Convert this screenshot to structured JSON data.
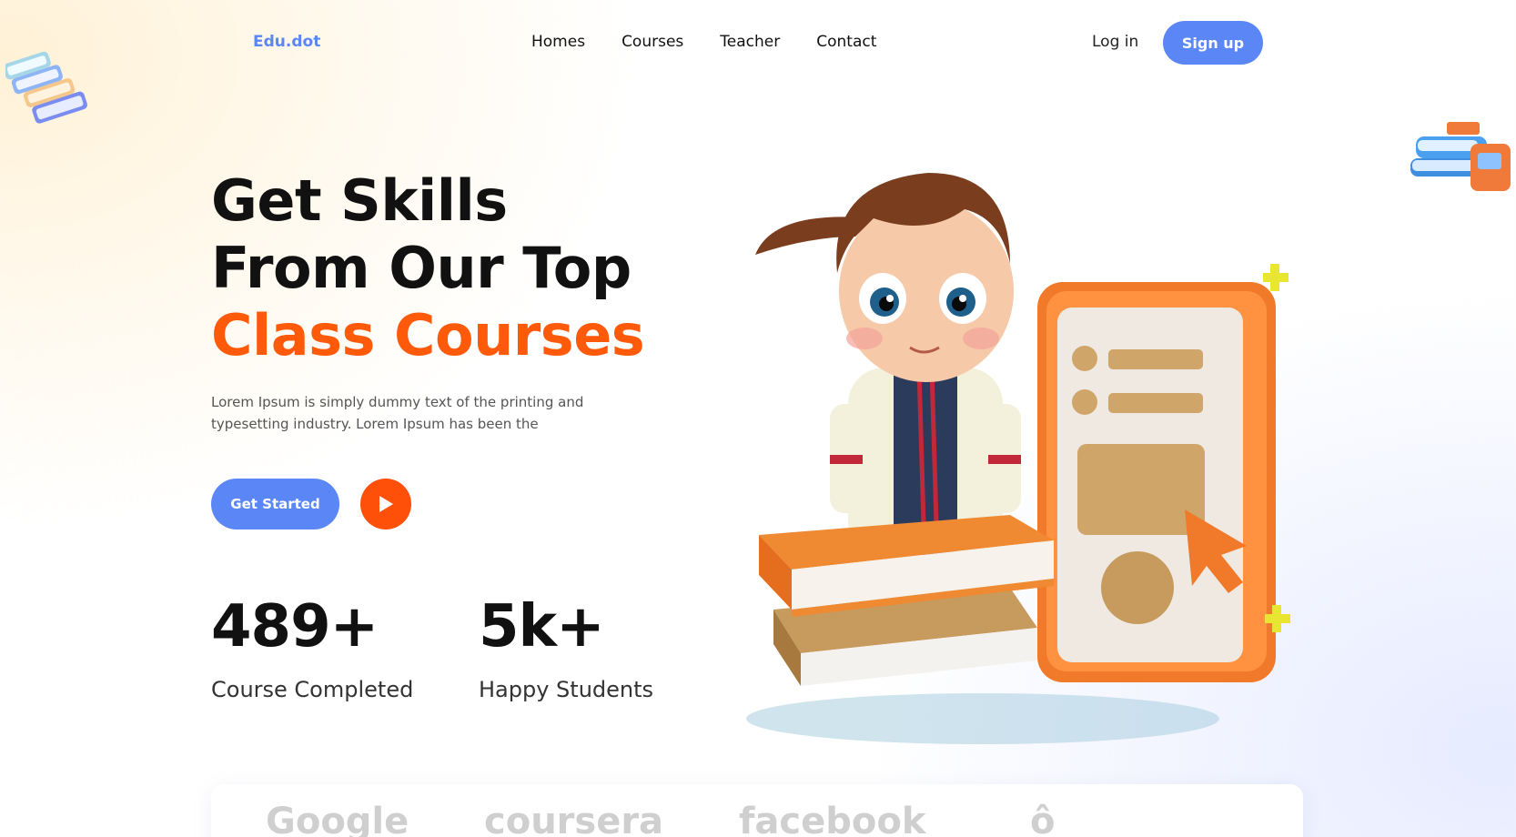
{
  "nav": {
    "logo": "Edu.dot",
    "links": [
      "Homes",
      "Courses",
      "Teacher",
      "Contact"
    ],
    "login": "Log in",
    "signup": "Sign up"
  },
  "hero": {
    "line1": "Get Skills",
    "line2": "From Our Top",
    "line3": "Class Courses",
    "description": "Lorem Ipsum is simply dummy text of the printing and typesetting industry. Lorem Ipsum has been the",
    "get_started": "Get Started",
    "play_icon": "play-icon"
  },
  "stats": [
    {
      "value": "489+",
      "label": "Course Completed"
    },
    {
      "value": "5k+",
      "label": "Happy Students"
    }
  ],
  "partners": [
    "Google",
    "coursera",
    "facebook",
    "ô"
  ],
  "colors": {
    "primary": "#5b86f5",
    "accent": "#ff5a0a"
  }
}
